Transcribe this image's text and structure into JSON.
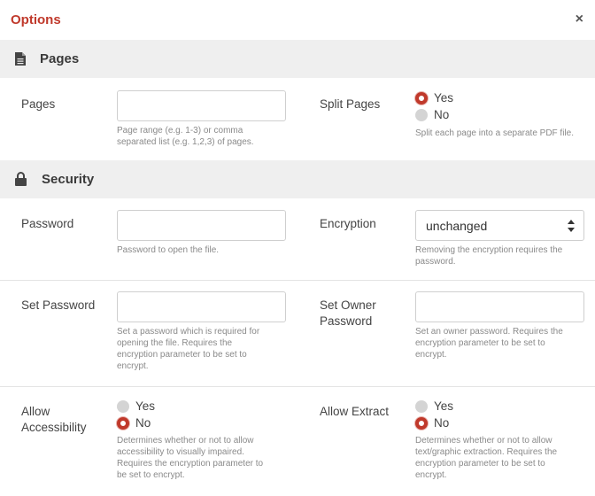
{
  "dialog": {
    "title": "Options",
    "close_glyph": "×"
  },
  "pages_section": {
    "title": "Pages",
    "icon": "file-icon",
    "pages": {
      "label": "Pages",
      "value": "",
      "help": [
        "Page range (e.g. 1-3) or comma",
        "separated list (e.g. 1,2,3) of pages."
      ]
    },
    "split_pages": {
      "label": "Split Pages",
      "options": [
        "Yes",
        "No"
      ],
      "selected": "Yes",
      "help": [
        "Split each page into a separate PDF file."
      ]
    }
  },
  "security_section": {
    "title": "Security",
    "icon": "lock-icon",
    "password": {
      "label": "Password",
      "value": "",
      "help": [
        "Password to open the file."
      ]
    },
    "encryption": {
      "label": "Encryption",
      "value": "unchanged",
      "help": [
        "Removing the encryption requires the",
        "password."
      ]
    },
    "set_password": {
      "label": "Set Password",
      "value": "",
      "help": [
        "Set a password which is required for",
        "opening the file. Requires the",
        "encryption parameter to be set to",
        "encrypt."
      ]
    },
    "set_owner_password": {
      "label": [
        "Set Owner",
        "Password"
      ],
      "value": "",
      "help": [
        "Set an owner password. Requires the",
        "encryption parameter to be set to",
        "encrypt."
      ]
    },
    "allow_accessibility": {
      "label": [
        "Allow",
        "Accessibility"
      ],
      "options": [
        "Yes",
        "No"
      ],
      "selected": "No",
      "help": [
        "Determines whether or not to allow",
        "accessibility to visually impaired.",
        "Requires the encryption parameter to",
        "be set to encrypt."
      ]
    },
    "allow_extract": {
      "label": "Allow Extract",
      "options": [
        "Yes",
        "No"
      ],
      "selected": "No",
      "help": [
        "Determines whether or not to allow",
        "text/graphic extraction. Requires the",
        "encryption parameter to be set to",
        "encrypt."
      ]
    }
  },
  "colors": {
    "accent": "#c0392b",
    "section_bg": "#efefef",
    "help_text": "#8a8a8a"
  }
}
